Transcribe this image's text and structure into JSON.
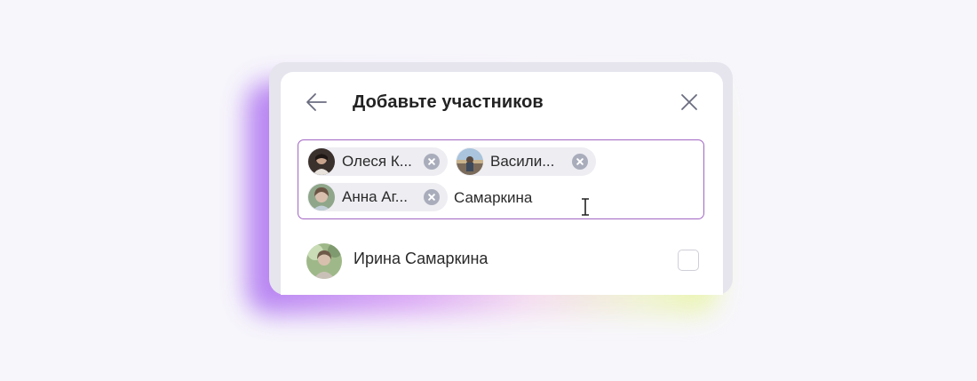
{
  "dialog": {
    "title": "Добавьте участников",
    "back_icon": "arrow-left-icon",
    "close_icon": "close-icon"
  },
  "picker": {
    "chips": [
      {
        "label": "Олеся К...",
        "avatar": "avatar-photo-olesya",
        "remove_icon": "remove-chip-icon"
      },
      {
        "label": "Васили...",
        "avatar": "avatar-photo-vasilisa",
        "remove_icon": "remove-chip-icon"
      },
      {
        "label": "Анна Аг...",
        "avatar": "avatar-photo-anna",
        "remove_icon": "remove-chip-icon"
      }
    ],
    "search_value": "Самаркина"
  },
  "results": [
    {
      "name": "Ирина Самаркина",
      "checked": false
    }
  ],
  "colors": {
    "accent_border": "#a266c4",
    "chip_bg": "#ededf2",
    "chip_remove": "#a9adbb"
  }
}
